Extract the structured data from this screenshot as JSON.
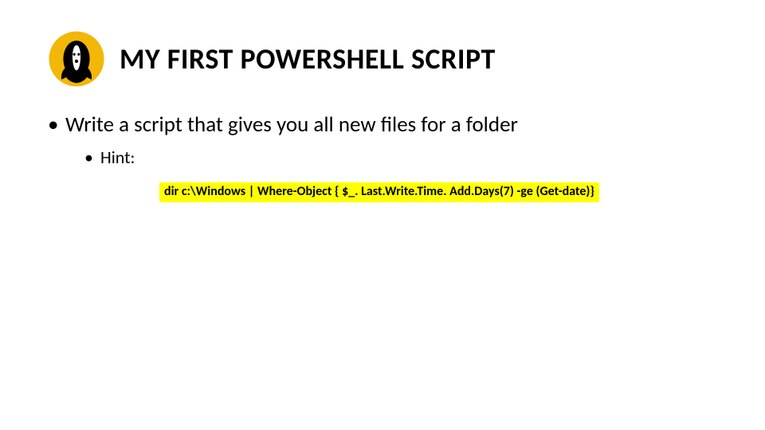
{
  "colors": {
    "highlight": "#ffff00",
    "emblem_bg": "#f2b707",
    "emblem_fg": "#000000"
  },
  "header": {
    "title": "MY FIRST POWERSHELL SCRIPT",
    "emblem_name": "badger-emblem"
  },
  "bullets": {
    "main": "Write a script that gives you all new files for a folder",
    "hint_label": "Hint:",
    "hint_code": "dir c:\\Windows | Where-Object { $_. Last.Write.Time. Add.Days(7) -ge (Get-date)}"
  }
}
